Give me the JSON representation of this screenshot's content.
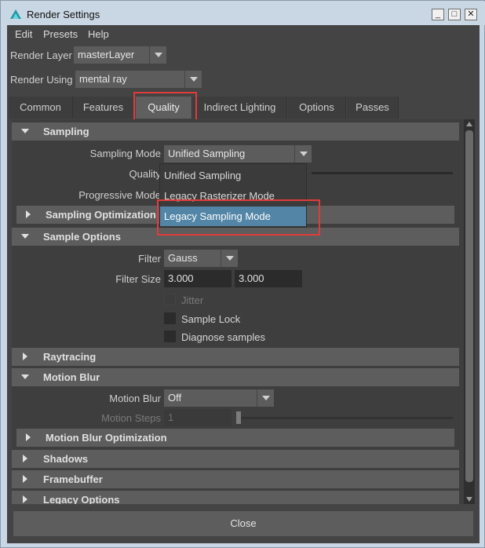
{
  "window": {
    "title": "Render Settings",
    "title_icon": "maya-app-icon"
  },
  "menu": [
    "Edit",
    "Presets",
    "Help"
  ],
  "render_layer": {
    "label": "Render Layer",
    "value": "masterLayer"
  },
  "render_using": {
    "label": "Render Using",
    "value": "mental ray"
  },
  "tabs": [
    "Common",
    "Features",
    "Quality",
    "Indirect Lighting",
    "Options",
    "Passes"
  ],
  "active_tab": "Quality",
  "sampling": {
    "header": "Sampling",
    "mode_label": "Sampling Mode",
    "mode_value": "Unified Sampling",
    "quality_label": "Quality",
    "progressive_label": "Progressive Mode",
    "options": [
      "Unified Sampling",
      "Legacy Rasterizer Mode",
      "Legacy Sampling Mode"
    ],
    "highlighted_option": "Legacy Sampling Mode"
  },
  "sampling_optimization": {
    "header": "Sampling Optimization"
  },
  "sample_options": {
    "header": "Sample Options",
    "filter_label": "Filter",
    "filter_value": "Gauss",
    "filter_size_label": "Filter Size",
    "filter_size_x": "3.000",
    "filter_size_y": "3.000",
    "jitter": "Jitter",
    "sample_lock": "Sample Lock",
    "diagnose": "Diagnose samples"
  },
  "raytracing": {
    "header": "Raytracing"
  },
  "motion_blur": {
    "header": "Motion Blur",
    "mb_label": "Motion Blur",
    "mb_value": "Off",
    "steps_label": "Motion Steps",
    "steps_value": "1"
  },
  "motion_blur_optimization": {
    "header": "Motion Blur Optimization"
  },
  "shadows": {
    "header": "Shadows"
  },
  "framebuffer": {
    "header": "Framebuffer"
  },
  "legacy_options": {
    "header": "Legacy Options"
  },
  "close_label": "Close",
  "colors": {
    "highlight_outline": "#e23b3b",
    "selection": "#5285a6",
    "background": "#444444"
  }
}
